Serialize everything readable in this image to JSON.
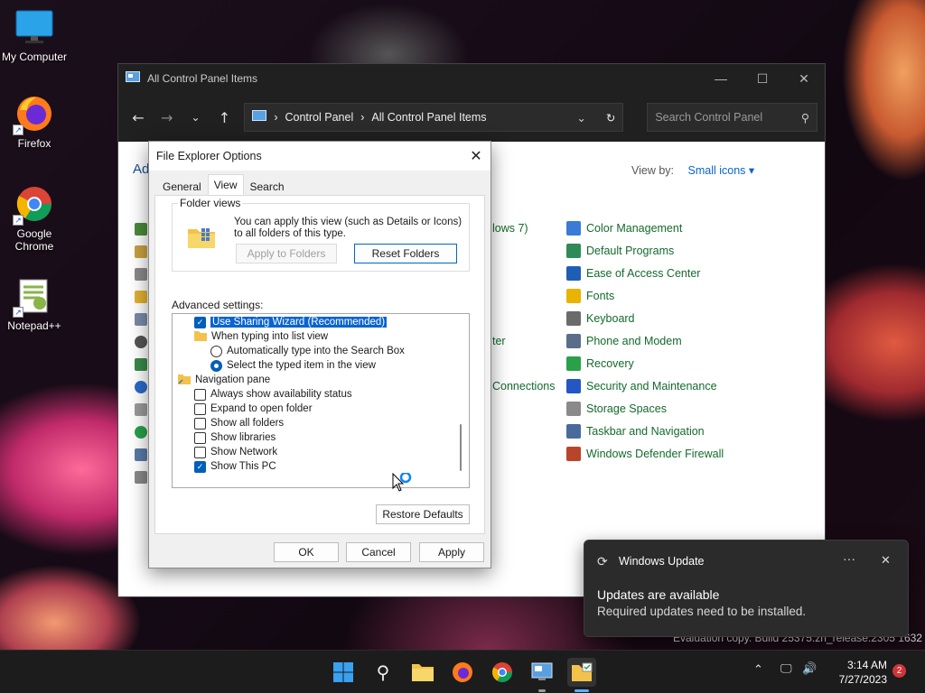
{
  "desktop": {
    "icons": [
      {
        "label": "My Computer"
      },
      {
        "label": "Firefox"
      },
      {
        "label": "Google Chrome"
      },
      {
        "label": "Notepad++"
      }
    ],
    "watermark": "Evaluation copy. Build 25375.zn_release.2305 1632"
  },
  "control_panel": {
    "title": "All Control Panel Items",
    "breadcrumb": [
      "Control Panel",
      "All Control Panel Items"
    ],
    "search_placeholder": "Search Control Panel",
    "heading_partial": "Ad",
    "view_by_label": "View by:",
    "view_by_value": "Small icons",
    "partial_items": [
      "lows 7)",
      "ter",
      "Connections"
    ],
    "items": [
      {
        "label": "Color Management",
        "color": "#3a7bd5"
      },
      {
        "label": "Default Programs",
        "color": "#2e8b57"
      },
      {
        "label": "Ease of Access Center",
        "color": "#1e5fb4"
      },
      {
        "label": "Fonts",
        "color": "#e8b400"
      },
      {
        "label": "Keyboard",
        "color": "#6b6b6b"
      },
      {
        "label": "Phone and Modem",
        "color": "#5a6e8a"
      },
      {
        "label": "Recovery",
        "color": "#2aa04a"
      },
      {
        "label": "Security and Maintenance",
        "color": "#2456c4"
      },
      {
        "label": "Storage Spaces",
        "color": "#8a8a8a"
      },
      {
        "label": "Taskbar and Navigation",
        "color": "#4a6a9a"
      },
      {
        "label": "Windows Defender Firewall",
        "color": "#b8452a"
      }
    ]
  },
  "dialog": {
    "title": "File Explorer Options",
    "tabs": [
      "General",
      "View",
      "Search"
    ],
    "active_tab": "View",
    "folder_views": {
      "title": "Folder views",
      "text": "You can apply this view (such as Details or Icons) to all folders of this type.",
      "apply_button": "Apply to Folders",
      "reset_button": "Reset Folders"
    },
    "advanced_label": "Advanced settings:",
    "advanced_rows": [
      {
        "type": "checkbox",
        "checked": true,
        "label": "Use Sharing Wizard (Recommended)",
        "indent": 1,
        "selected": true
      },
      {
        "type": "folder",
        "label": "When typing into list view",
        "indent": 1
      },
      {
        "type": "radio",
        "checked": false,
        "label": "Automatically type into the Search Box",
        "indent": 2
      },
      {
        "type": "radio",
        "checked": true,
        "label": "Select the typed item in the view",
        "indent": 2
      },
      {
        "type": "nav",
        "label": "Navigation pane",
        "indent": 0
      },
      {
        "type": "checkbox",
        "checked": false,
        "label": "Always show availability status",
        "indent": 1
      },
      {
        "type": "checkbox",
        "checked": false,
        "label": "Expand to open folder",
        "indent": 1
      },
      {
        "type": "checkbox",
        "checked": false,
        "label": "Show all folders",
        "indent": 1
      },
      {
        "type": "checkbox",
        "checked": false,
        "label": "Show libraries",
        "indent": 1
      },
      {
        "type": "checkbox",
        "checked": false,
        "label": "Show Network",
        "indent": 1
      },
      {
        "type": "checkbox",
        "checked": true,
        "label": "Show This PC",
        "indent": 1
      }
    ],
    "restore_button": "Restore Defaults",
    "ok_button": "OK",
    "cancel_button": "Cancel",
    "apply_button": "Apply"
  },
  "toast": {
    "app": "Windows Update",
    "heading": "Updates are available",
    "body": "Required updates need to be installed.",
    "more_glyph": "···",
    "close_glyph": "✕"
  },
  "taskbar": {
    "time": "3:14 AM",
    "date": "7/27/2023",
    "notification_count": "2"
  }
}
